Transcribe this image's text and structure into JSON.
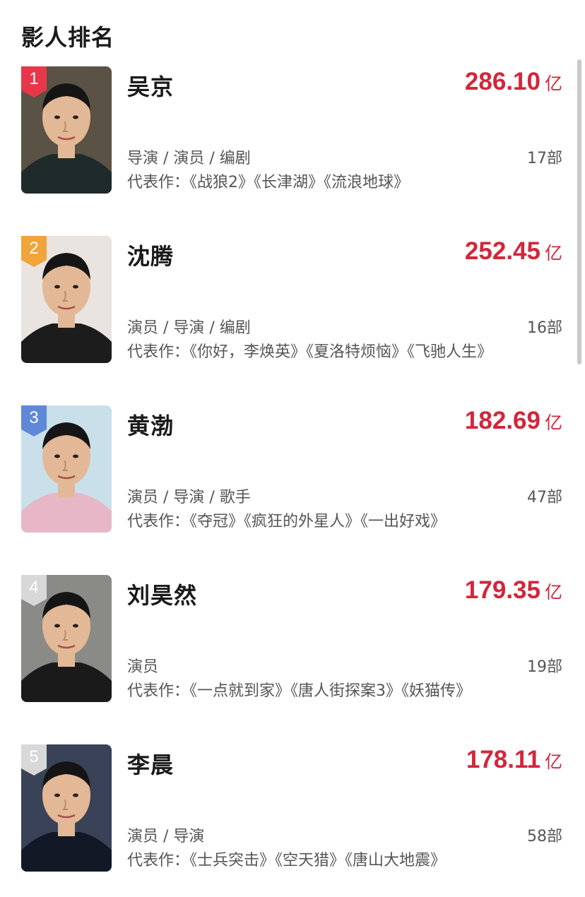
{
  "section": {
    "title": "影人排名"
  },
  "rankings": [
    {
      "rank": "1",
      "name": "吴京",
      "box_office": "286.10",
      "unit": "亿",
      "roles": "导演 / 演员 / 编剧",
      "count": "17部",
      "works": "代表作：《战狼2》《长津湖》《流浪地球》",
      "badge_color": "#e8364a",
      "shirt_color": "#1f2a2a",
      "bg_color": "#5a5244"
    },
    {
      "rank": "2",
      "name": "沈腾",
      "box_office": "252.45",
      "unit": "亿",
      "roles": "演员 / 导演 / 编剧",
      "count": "16部",
      "works": "代表作：《你好，李焕英》《夏洛特烦恼》《飞驰人生》",
      "badge_color": "#f1a43a",
      "shirt_color": "#1c1c1c",
      "bg_color": "#e9e4df"
    },
    {
      "rank": "3",
      "name": "黄渤",
      "box_office": "182.69",
      "unit": "亿",
      "roles": "演员 / 导演 / 歌手",
      "count": "47部",
      "works": "代表作：《夺冠》《疯狂的外星人》《一出好戏》",
      "badge_color": "#5f88d8",
      "shirt_color": "#e8b7c7",
      "bg_color": "#c9e0ea"
    },
    {
      "rank": "4",
      "name": "刘昊然",
      "box_office": "179.35",
      "unit": "亿",
      "roles": "演员",
      "count": "19部",
      "works": "代表作：《一点就到家》《唐人街探案3》《妖猫传》",
      "badge_color": "#d8d8d8",
      "shirt_color": "#1a1a1a",
      "bg_color": "#8a8a86"
    },
    {
      "rank": "5",
      "name": "李晨",
      "box_office": "178.11",
      "unit": "亿",
      "roles": "演员 / 导演",
      "count": "58部",
      "works": "代表作：《士兵突击》《空天猎》《唐山大地震》",
      "badge_color": "#d8d8d8",
      "shirt_color": "#121826",
      "bg_color": "#3a4258"
    }
  ]
}
